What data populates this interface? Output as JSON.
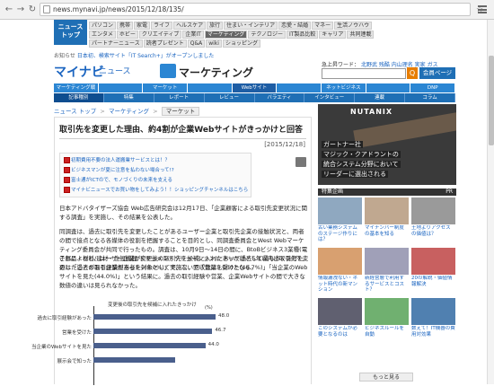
{
  "browser": {
    "url": "news.mynavi.jp/news/2015/12/18/135/"
  },
  "site_logo_top": "ニュース\nトップ",
  "nav_rows": [
    [
      "パソコン",
      "携帯",
      "家電",
      "ライフ",
      "ヘルスケア",
      "旅行",
      "住まい・インテリア",
      "恋愛・結婚",
      "マネー",
      "生活ノウハウ"
    ],
    [
      "エンタメ",
      "ホビー",
      "クリエイティブ",
      "企業IT",
      "マーケティング",
      "テクノロジー",
      "IT製品比較",
      "キャリア",
      "共同連載"
    ],
    [
      "パートナーニュース",
      "読者プレゼント",
      "Q&A",
      "wiki",
      "ショッピング"
    ]
  ],
  "nav_highlight": "マーケティング",
  "osusume": {
    "label": "お知らせ",
    "text": "日本初、検索サイト「IT Search+」がオープンしました"
  },
  "top_right_links": "新しい書籍案内",
  "brand": {
    "mark": "マイナビ",
    "news": "ニュース",
    "section": "マーケティング"
  },
  "keyword_label": "急上昇ワード：",
  "keywords": "北野武 残酷 内山理名 実家 ガス",
  "search_btn": "Q",
  "kaiin_btn": "会員ページ",
  "category_bar": [
    "マーケティング戦略",
    "",
    "マーケット",
    "",
    "Webサイト",
    "",
    "ネットビジネス",
    "",
    "DNP"
  ],
  "category_on": 4,
  "sub_bar": [
    "記事種別",
    "特集",
    "レポート",
    "レビュー",
    "バラエティ",
    "インタビュー",
    "連載",
    "コラム"
  ],
  "breadcrumb": [
    "ニュース トップ",
    "マーケティング",
    "マーケット"
  ],
  "article": {
    "title": "取引先を変更した理由、約4割が企業Webサイトがきっかけと回答",
    "date": "[2015/12/18]",
    "related": [
      "初期費用不要の法人運搬業サービスとは！？",
      "ビジネスマンが夏に注意を払わない場合って!?",
      "富士通がICTので、モノづくりの未来を支える",
      "マイナビニュースでお買い物をしてみよう！！ショッピングチャンネルはこちらから♪"
    ],
    "p1": "日本アドバタイザーズ協会 Web広告研究会は12月17日、「企業顧客による取引先変更状況に関する調査」を実施し、その結果を公表した。",
    "p2": "同調査は、過去に取引先を変更したことがあるユーザー企業と取引先企業の接触状況と、両者の間で接点となる各媒体の役割を把握することを目的とし、同調査委員会とWest Webマーケティング委員会が共同で行ったもの。調査は、10月9日～14日の間に、BtoBビジネス3業種(電子部品・材料/建材・住設機器/ドキュメントソリューション)において過去5年以内に取引先を変更したことがある企業担当者を対象として実施し、回収数は3,000となる。",
    "p3": "これによると、ユーザー企業が変更後の取引先を候補に入れたきっかけとして最も多くあげたのは「過去の取引経験があった(48.0%)」で、次いで「営業を受けた(46.7%)」「当企業のWebサイトを見た(44.0%)」という結果に。過去の取引経験や営業、企業Webサイトの間で大きな数値の違いは見られなかった。"
  },
  "chart_data": {
    "type": "bar",
    "title": "変更後の取引先を候補に入れたきっかけ",
    "ylabel": "(%)",
    "categories": [
      "過去に取引経験があった",
      "営業を受けた",
      "当企業のWebサイトを見た",
      "展示会で知った"
    ],
    "values": [
      48.0,
      46.7,
      44.0,
      32.0
    ],
    "value_labels": [
      "48.0",
      "46.7",
      "44.0",
      ""
    ],
    "xlim": [
      0,
      60
    ]
  },
  "sidebar": {
    "ad_brand": "NUTANIX",
    "ad_text": [
      "ガートナー社",
      "マジック・クアドラントの",
      "統合システム分野において",
      "リーダーに選出される"
    ],
    "tokushu_label": "特集企画",
    "tokushu_pr": "PR",
    "items": [
      {
        "cap": "古い業務システムのステージ作りには？"
      },
      {
        "cap": "マイナンバー制度の基本を知る"
      },
      {
        "cap": "土地よりアクセスの価値は？"
      },
      {
        "cap": "情報漏洩ない・ネット時代の新マンション"
      },
      {
        "cap": "新経営層で利用するサービスとコスト？"
      },
      {
        "cap": "20の解説・価値情報解決"
      },
      {
        "cap": "このシステムが必要となるのは"
      },
      {
        "cap": "ビジネスルールを自動"
      },
      {
        "cap": "数えて！IT機器の費用対効果"
      }
    ],
    "more_label": "もっと見る"
  }
}
